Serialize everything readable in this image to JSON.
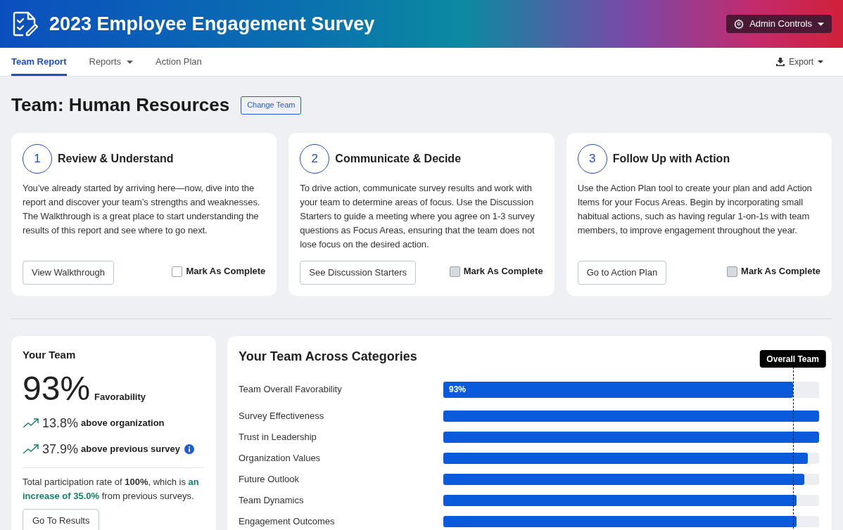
{
  "header": {
    "title": "2023 Employee Engagement Survey",
    "admin_button": "Admin Controls"
  },
  "nav": {
    "tabs": [
      {
        "label": "Team Report",
        "selected": true,
        "dropdown": false
      },
      {
        "label": "Reports",
        "selected": false,
        "dropdown": true
      },
      {
        "label": "Action Plan",
        "selected": false,
        "dropdown": false
      }
    ],
    "export": "Export"
  },
  "team": {
    "title": "Team: Human Resources",
    "change_button": "Change Team"
  },
  "steps": [
    {
      "number": "1",
      "title": "Review & Understand",
      "text": "You’ve already started by arriving here—now, dive into the report and discover your team’s strengths and weaknesses. The Walkthrough is a great place to start understanding the results of this report and see where to go next.",
      "button": "View Walkthrough",
      "complete_label": "Mark As Complete",
      "checked": false
    },
    {
      "number": "2",
      "title": "Communicate & Decide",
      "text": "To drive action, communicate survey results and work with your team to determine areas of focus. Use the Discussion Starters to guide a meeting where you agree on 1-3 survey questions as Focus Areas, ensuring that the team does not lose focus on the desired action.",
      "button": "See Discussion Starters",
      "complete_label": "Mark As Complete",
      "checked": false
    },
    {
      "number": "3",
      "title": "Follow Up with Action",
      "text": "Use the Action Plan tool to create your plan and add Action Items for your Focus Areas. Begin by incorporating small habitual actions, such as having regular 1-on-1s with team members, to improve engagement throughout the year.",
      "button": "Go to Action Plan",
      "complete_label": "Mark As Complete",
      "checked": false
    }
  ],
  "your_team": {
    "title": "Your Team",
    "score": "93%",
    "score_label": "Favorability",
    "comparisons": [
      {
        "value": "13.8%",
        "label": "above organization",
        "info": false
      },
      {
        "value": "37.9%",
        "label": "above previous survey",
        "info": true
      }
    ],
    "participation": "Total participation rate of **100%**, which is **an increase of 35.0%** from previous surveys.",
    "button": "Go To Results"
  },
  "categories": {
    "title": "Your Team Across Categories",
    "reference_label": "Overall Team",
    "rows": [
      {
        "label": "Team Overall Favorability",
        "level": 0.93,
        "value_label": "93%"
      },
      {
        "label": "Survey Effectiveness",
        "level": 1.0
      },
      {
        "label": "Trust in Leadership",
        "level": 1.0
      },
      {
        "label": "Organization Values",
        "level": 0.97
      },
      {
        "label": "Future Outlook",
        "level": 0.96
      },
      {
        "label": "Team Dynamics",
        "level": 0.94
      },
      {
        "label": "Engagement Outcomes",
        "level": 0.94
      }
    ]
  }
}
